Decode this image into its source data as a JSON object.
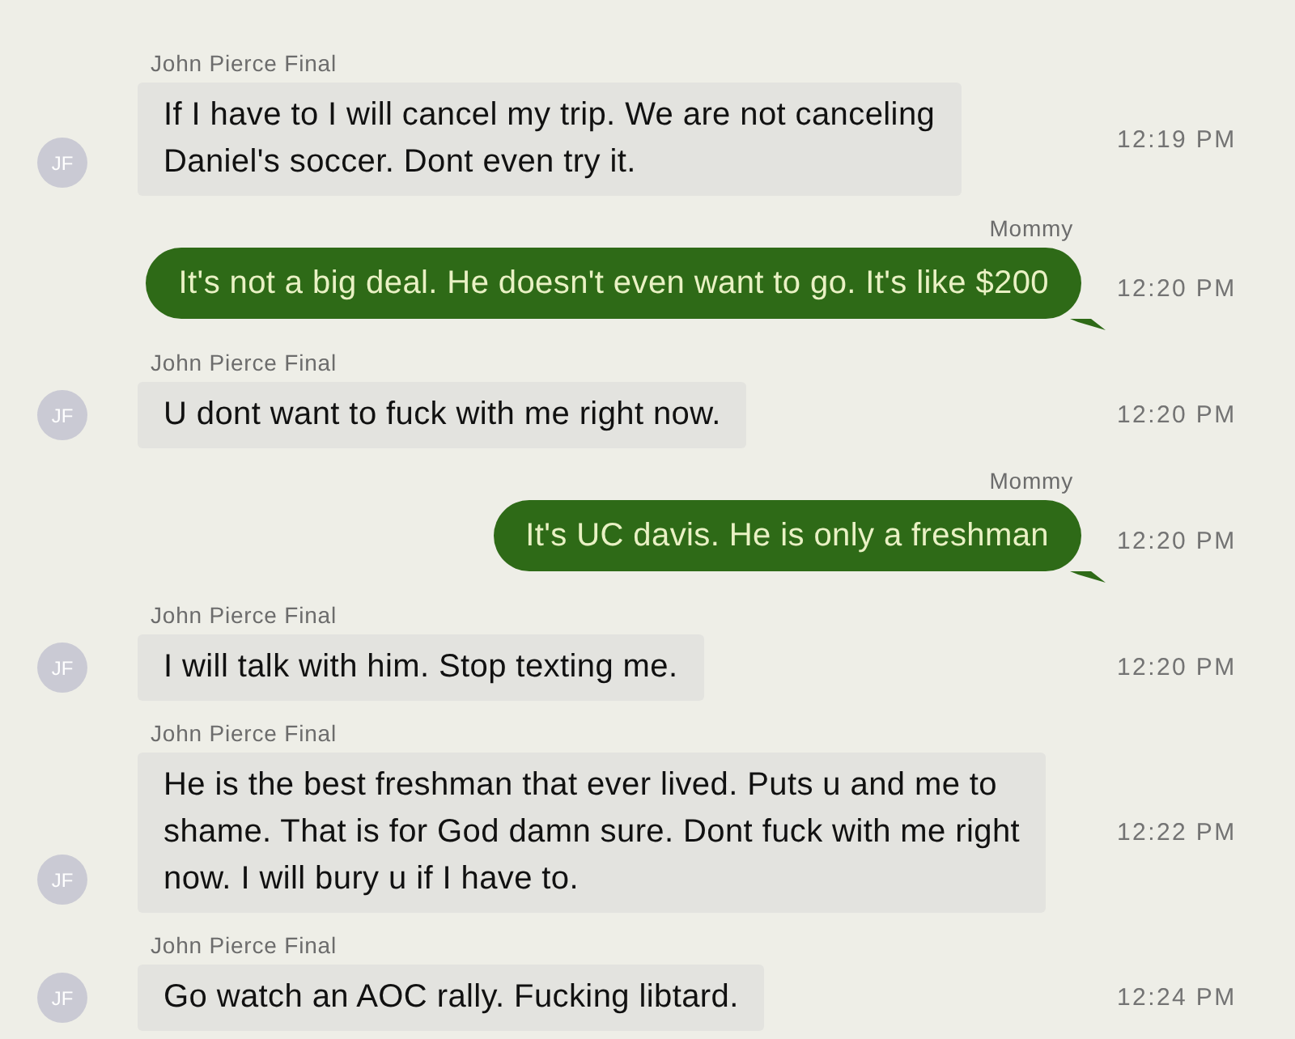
{
  "messages": [
    {
      "kind": "incoming",
      "sender": "John Pierce Final",
      "avatar": "JF",
      "lines": [
        "If I have to I will cancel my trip. We are not canceling",
        "Daniel's soccer. Dont even try it."
      ],
      "time": "12:19 PM"
    },
    {
      "kind": "outgoing",
      "sender": "Mommy",
      "lines": [
        "It's not a big deal. He doesn't even want to go. It's like $200"
      ],
      "time": "12:20 PM"
    },
    {
      "kind": "incoming",
      "sender": "John Pierce Final",
      "avatar": "JF",
      "lines": [
        "U dont want to fuck with me right now."
      ],
      "time": "12:20 PM"
    },
    {
      "kind": "outgoing",
      "sender": "Mommy",
      "lines": [
        "It's UC davis. He is only a freshman"
      ],
      "time": "12:20 PM"
    },
    {
      "kind": "incoming",
      "sender": "John Pierce Final",
      "avatar": "JF",
      "lines": [
        "I will talk with him. Stop texting me."
      ],
      "time": "12:20 PM"
    },
    {
      "kind": "incoming",
      "sender": "John Pierce Final",
      "avatar": "JF",
      "lines": [
        "He is the best freshman that ever lived. Puts u and me to",
        "shame. That is for God damn sure. Dont fuck with me right",
        "now. I will bury u if I have to."
      ],
      "time": "12:22 PM"
    },
    {
      "kind": "incoming",
      "sender": "John Pierce Final",
      "avatar": "JF",
      "lines": [
        "Go watch an AOC rally. Fucking libtard."
      ],
      "time": "12:24 PM"
    }
  ]
}
